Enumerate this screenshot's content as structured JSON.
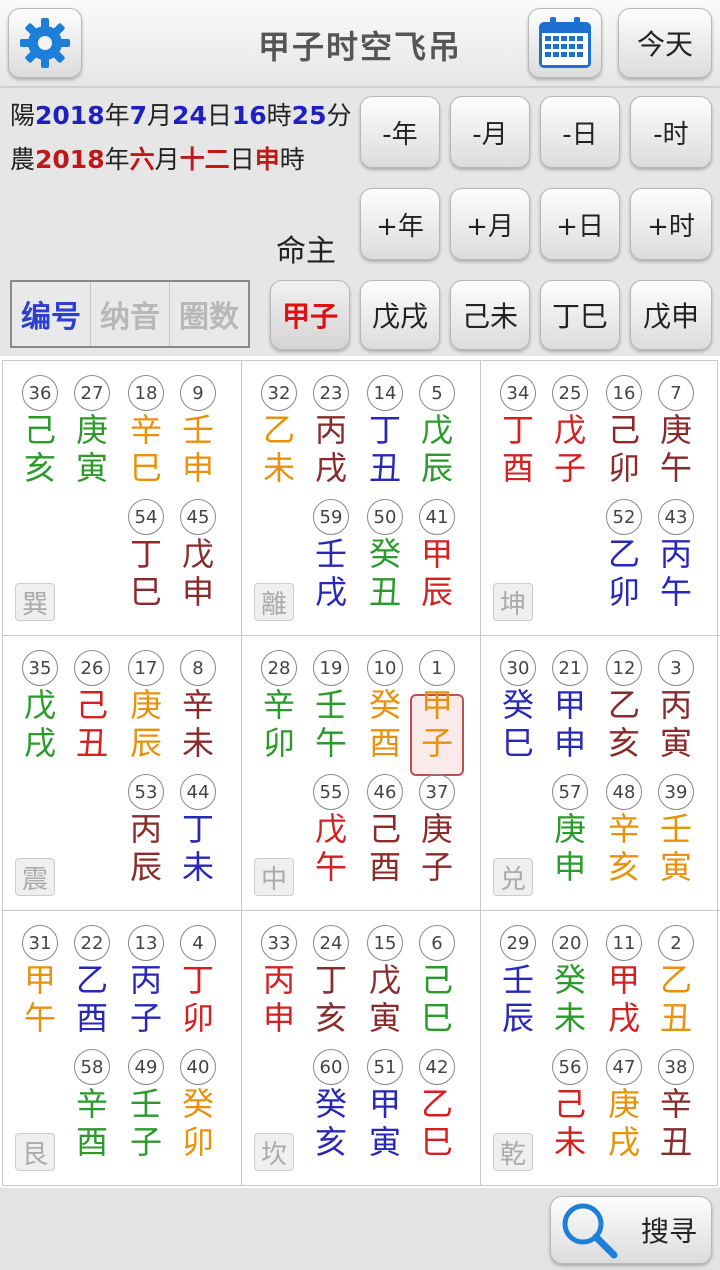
{
  "header": {
    "title": "甲子时空飞吊",
    "today_label": "今天"
  },
  "date": {
    "solar": {
      "prefix": "陽",
      "year": "2018",
      "y": "年",
      "month": "7",
      "m": "月",
      "day": "24",
      "d": "日",
      "hour": "16",
      "h": "時",
      "minute": "25",
      "mi": "分"
    },
    "lunar": {
      "prefix": "農",
      "year": "2018",
      "y": "年",
      "month": "六",
      "m": "月",
      "day": "十二",
      "d": "日",
      "hour": "申",
      "h": "時"
    }
  },
  "adjust": [
    {
      "label": "-年"
    },
    {
      "label": "-月"
    },
    {
      "label": "-日"
    },
    {
      "label": "-时"
    },
    {
      "label": "+年"
    },
    {
      "label": "+月"
    },
    {
      "label": "+日"
    },
    {
      "label": "+时"
    }
  ],
  "mingzhu_label": "命主",
  "tabs": [
    {
      "label": "编号"
    },
    {
      "label": "纳音"
    },
    {
      "label": "圈数"
    }
  ],
  "ganzhi": [
    {
      "label": "甲子"
    },
    {
      "label": "戊戌"
    },
    {
      "label": "己未"
    },
    {
      "label": "丁巳"
    },
    {
      "label": "戊申"
    }
  ],
  "colors": {
    "wood": "#2a9a2a",
    "fire": "#d42020",
    "earth": "#e8920c",
    "metal": "#8a2a2a",
    "water": "#2828b8"
  },
  "palaces": [
    {
      "trigram": "巽",
      "cells": [
        {
          "n": "36",
          "t": [
            "己",
            "亥"
          ],
          "c": [
            "wood",
            "wood"
          ]
        },
        {
          "n": "27",
          "t": [
            "庚",
            "寅"
          ],
          "c": [
            "wood",
            "wood"
          ]
        },
        {
          "n": "18",
          "t": [
            "辛",
            "巳"
          ],
          "c": [
            "earth",
            "earth"
          ]
        },
        {
          "n": "9",
          "t": [
            "壬",
            "申"
          ],
          "c": [
            "earth",
            "earth"
          ]
        },
        {
          "n": "54",
          "t": [
            "丁",
            "巳"
          ],
          "c": [
            "metal",
            "metal"
          ]
        },
        {
          "n": "45",
          "t": [
            "戊",
            "申"
          ],
          "c": [
            "metal",
            "metal"
          ]
        }
      ]
    },
    {
      "trigram": "離",
      "cells": [
        {
          "n": "32",
          "t": [
            "乙",
            "未"
          ],
          "c": [
            "earth",
            "earth"
          ]
        },
        {
          "n": "23",
          "t": [
            "丙",
            "戌"
          ],
          "c": [
            "metal",
            "metal"
          ]
        },
        {
          "n": "14",
          "t": [
            "丁",
            "丑"
          ],
          "c": [
            "water",
            "water"
          ]
        },
        {
          "n": "5",
          "t": [
            "戊",
            "辰"
          ],
          "c": [
            "wood",
            "wood"
          ]
        },
        {
          "n": "59",
          "t": [
            "壬",
            "戌"
          ],
          "c": [
            "water",
            "water"
          ]
        },
        {
          "n": "50",
          "t": [
            "癸",
            "丑"
          ],
          "c": [
            "wood",
            "wood"
          ]
        },
        {
          "n": "41",
          "t": [
            "甲",
            "辰"
          ],
          "c": [
            "fire",
            "fire"
          ]
        }
      ]
    },
    {
      "trigram": "坤",
      "cells": [
        {
          "n": "34",
          "t": [
            "丁",
            "酉"
          ],
          "c": [
            "fire",
            "fire"
          ]
        },
        {
          "n": "25",
          "t": [
            "戊",
            "子"
          ],
          "c": [
            "fire",
            "fire"
          ]
        },
        {
          "n": "16",
          "t": [
            "己",
            "卯"
          ],
          "c": [
            "metal",
            "metal"
          ]
        },
        {
          "n": "7",
          "t": [
            "庚",
            "午"
          ],
          "c": [
            "metal",
            "metal"
          ]
        },
        {
          "n": "52",
          "t": [
            "乙",
            "卯"
          ],
          "c": [
            "water",
            "water"
          ]
        },
        {
          "n": "43",
          "t": [
            "丙",
            "午"
          ],
          "c": [
            "water",
            "water"
          ]
        }
      ]
    },
    {
      "trigram": "震",
      "cells": [
        {
          "n": "35",
          "t": [
            "戊",
            "戌"
          ],
          "c": [
            "wood",
            "wood"
          ]
        },
        {
          "n": "26",
          "t": [
            "己",
            "丑"
          ],
          "c": [
            "fire",
            "fire"
          ]
        },
        {
          "n": "17",
          "t": [
            "庚",
            "辰"
          ],
          "c": [
            "earth",
            "earth"
          ]
        },
        {
          "n": "8",
          "t": [
            "辛",
            "未"
          ],
          "c": [
            "metal",
            "metal"
          ]
        },
        {
          "n": "53",
          "t": [
            "丙",
            "辰"
          ],
          "c": [
            "metal",
            "metal"
          ]
        },
        {
          "n": "44",
          "t": [
            "丁",
            "未"
          ],
          "c": [
            "water",
            "water"
          ]
        }
      ]
    },
    {
      "trigram": "中",
      "cells": [
        {
          "n": "28",
          "t": [
            "辛",
            "卯"
          ],
          "c": [
            "wood",
            "wood"
          ]
        },
        {
          "n": "19",
          "t": [
            "壬",
            "午"
          ],
          "c": [
            "wood",
            "wood"
          ]
        },
        {
          "n": "10",
          "t": [
            "癸",
            "酉"
          ],
          "c": [
            "earth",
            "earth"
          ]
        },
        {
          "n": "1",
          "t": [
            "甲",
            "子"
          ],
          "c": [
            "earth",
            "earth"
          ]
        },
        {
          "n": "55",
          "t": [
            "戊",
            "午"
          ],
          "c": [
            "fire",
            "fire"
          ]
        },
        {
          "n": "46",
          "t": [
            "己",
            "酉"
          ],
          "c": [
            "metal",
            "metal"
          ]
        },
        {
          "n": "37",
          "t": [
            "庚",
            "子"
          ],
          "c": [
            "metal",
            "metal"
          ]
        }
      ]
    },
    {
      "trigram": "兑",
      "cells": [
        {
          "n": "30",
          "t": [
            "癸",
            "巳"
          ],
          "c": [
            "water",
            "water"
          ]
        },
        {
          "n": "21",
          "t": [
            "甲",
            "申"
          ],
          "c": [
            "water",
            "water"
          ]
        },
        {
          "n": "12",
          "t": [
            "乙",
            "亥"
          ],
          "c": [
            "metal",
            "metal"
          ]
        },
        {
          "n": "3",
          "t": [
            "丙",
            "寅"
          ],
          "c": [
            "metal",
            "metal"
          ]
        },
        {
          "n": "57",
          "t": [
            "庚",
            "申"
          ],
          "c": [
            "wood",
            "wood"
          ]
        },
        {
          "n": "48",
          "t": [
            "辛",
            "亥"
          ],
          "c": [
            "earth",
            "earth"
          ]
        },
        {
          "n": "39",
          "t": [
            "壬",
            "寅"
          ],
          "c": [
            "earth",
            "earth"
          ]
        }
      ]
    },
    {
      "trigram": "艮",
      "cells": [
        {
          "n": "31",
          "t": [
            "甲",
            "午"
          ],
          "c": [
            "earth",
            "earth"
          ]
        },
        {
          "n": "22",
          "t": [
            "乙",
            "酉"
          ],
          "c": [
            "water",
            "water"
          ]
        },
        {
          "n": "13",
          "t": [
            "丙",
            "子"
          ],
          "c": [
            "water",
            "water"
          ]
        },
        {
          "n": "4",
          "t": [
            "丁",
            "卯"
          ],
          "c": [
            "fire",
            "fire"
          ]
        },
        {
          "n": "58",
          "t": [
            "辛",
            "酉"
          ],
          "c": [
            "wood",
            "wood"
          ]
        },
        {
          "n": "49",
          "t": [
            "壬",
            "子"
          ],
          "c": [
            "wood",
            "wood"
          ]
        },
        {
          "n": "40",
          "t": [
            "癸",
            "卯"
          ],
          "c": [
            "earth",
            "earth"
          ]
        }
      ]
    },
    {
      "trigram": "坎",
      "cells": [
        {
          "n": "33",
          "t": [
            "丙",
            "申"
          ],
          "c": [
            "fire",
            "fire"
          ]
        },
        {
          "n": "24",
          "t": [
            "丁",
            "亥"
          ],
          "c": [
            "metal",
            "metal"
          ]
        },
        {
          "n": "15",
          "t": [
            "戊",
            "寅"
          ],
          "c": [
            "metal",
            "metal"
          ]
        },
        {
          "n": "6",
          "t": [
            "己",
            "巳"
          ],
          "c": [
            "wood",
            "wood"
          ]
        },
        {
          "n": "60",
          "t": [
            "癸",
            "亥"
          ],
          "c": [
            "water",
            "water"
          ]
        },
        {
          "n": "51",
          "t": [
            "甲",
            "寅"
          ],
          "c": [
            "water",
            "water"
          ]
        },
        {
          "n": "42",
          "t": [
            "乙",
            "巳"
          ],
          "c": [
            "fire",
            "fire"
          ]
        }
      ]
    },
    {
      "trigram": "乾",
      "cells": [
        {
          "n": "29",
          "t": [
            "壬",
            "辰"
          ],
          "c": [
            "water",
            "water"
          ]
        },
        {
          "n": "20",
          "t": [
            "癸",
            "未"
          ],
          "c": [
            "wood",
            "wood"
          ]
        },
        {
          "n": "11",
          "t": [
            "甲",
            "戌"
          ],
          "c": [
            "fire",
            "fire"
          ]
        },
        {
          "n": "2",
          "t": [
            "乙",
            "丑"
          ],
          "c": [
            "earth",
            "earth"
          ]
        },
        {
          "n": "56",
          "t": [
            "己",
            "未"
          ],
          "c": [
            "fire",
            "fire"
          ]
        },
        {
          "n": "47",
          "t": [
            "庚",
            "戌"
          ],
          "c": [
            "earth",
            "earth"
          ]
        },
        {
          "n": "38",
          "t": [
            "辛",
            "丑"
          ],
          "c": [
            "metal",
            "metal"
          ]
        }
      ]
    }
  ],
  "search_label": "搜寻"
}
